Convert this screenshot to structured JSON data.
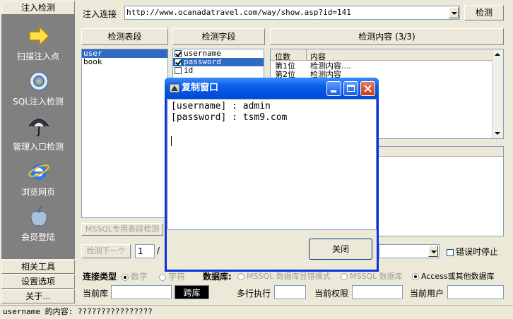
{
  "sidebar": {
    "header": "注入检测",
    "items": [
      {
        "label": "扫描注入点",
        "icon": "arrow-right-icon"
      },
      {
        "label": "SQL注入检测",
        "icon": "target-icon"
      },
      {
        "label": "管理入口检测",
        "icon": "umbrella-icon"
      },
      {
        "label": "浏览网页",
        "icon": "ie-browser-icon"
      },
      {
        "label": "会员登陆",
        "icon": "apple-icon"
      }
    ],
    "bottom": [
      "相关工具",
      "设置选项",
      "关于..."
    ]
  },
  "top": {
    "url_label": "注入连接",
    "url_value": "http://www.ocanadatravel.com/way/show.asp?id=141",
    "detect_button": "检测"
  },
  "panels": {
    "tables_header": "检测表段",
    "fields_header": "检测字段",
    "content_header": "检测内容 (3/3)",
    "tables": [
      "user",
      "book"
    ],
    "fields": [
      {
        "name": "username",
        "checked": true
      },
      {
        "name": "password",
        "checked": true
      },
      {
        "name": "id",
        "checked": false
      }
    ],
    "content_cols": [
      "位数",
      "内容"
    ],
    "content_rows": [
      [
        "第1位",
        "检测内容...."
      ],
      [
        "第2位",
        "检测内容"
      ]
    ],
    "mssql_button": "MSSQL专用表段检测"
  },
  "controls": {
    "next_button": "检测下一个",
    "page_value": "1",
    "page_sep": "/",
    "stop_on_error": "错误时停止"
  },
  "conn": {
    "type_label": "连接类型",
    "type_options": [
      "数字",
      "字符"
    ],
    "db_label": "数据库:",
    "db_options": [
      "MSSQL 数据库显错模式",
      "MSSQL 数据库",
      "Access或其他数据库"
    ],
    "current_db": "当前库",
    "cross_db": "跨库",
    "multi_exec": "多行执行",
    "current_perm": "当前权限",
    "current_user": "当前用户"
  },
  "status": "username 的内容: ????????????????",
  "dialog": {
    "title": "复制窗口",
    "lines": [
      "[username] : admin",
      "[password] : tsm9.com"
    ],
    "close_button": "关闭"
  }
}
